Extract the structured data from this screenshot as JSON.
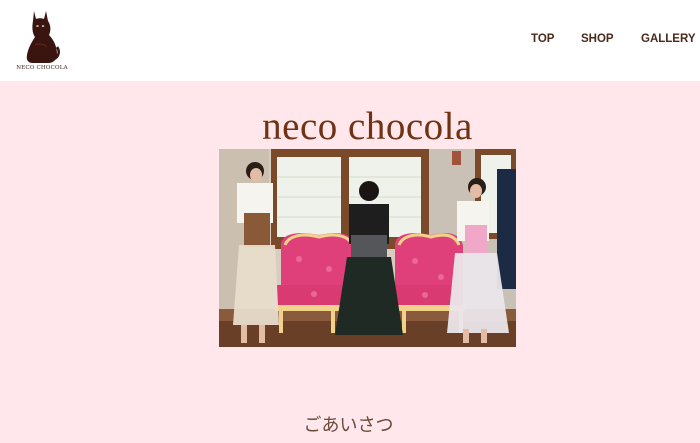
{
  "logo": {
    "text": "NECO CHOCOLA"
  },
  "nav": {
    "items": [
      {
        "label": "TOP"
      },
      {
        "label": "SHOP"
      },
      {
        "label": "GALLERY"
      }
    ]
  },
  "main": {
    "title": "neco chocola",
    "section_heading": "ごあいさつ"
  },
  "hero": {
    "icon": "photo-three-models-with-pink-sofa"
  },
  "colors": {
    "background": "#ffe7ec",
    "header": "#ffffff",
    "title": "#6f3214",
    "nav_text": "#4a2a1c"
  }
}
